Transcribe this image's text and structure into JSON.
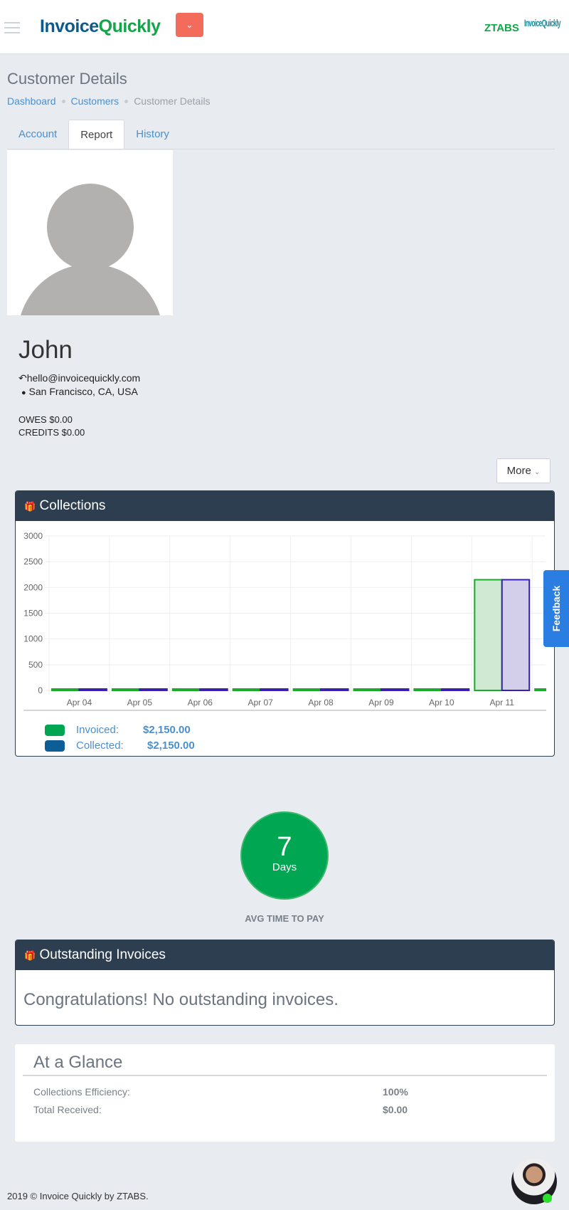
{
  "header": {
    "logo_part1": "Invoice",
    "logo_part2": "Quickly",
    "dropdown_icon": "chevron-down",
    "company": "ZTABS",
    "partner_logo": "InvoiceQuickly"
  },
  "page": {
    "title": "Customer Details",
    "breadcrumb": [
      "Dashboard",
      "Customers",
      "Customer Details"
    ]
  },
  "tabs": [
    {
      "label": "Account"
    },
    {
      "label": "Report"
    },
    {
      "label": "History"
    }
  ],
  "customer": {
    "name": "John",
    "email": "hello@invoicequickly.com",
    "location": "San Francisco, CA, USA",
    "owes": "OWES $0.00",
    "credits": "CREDITS $0.00"
  },
  "more_label": "More",
  "feedback_label": "Feedback",
  "collections": {
    "title": "Collections",
    "legend": [
      {
        "label": "Invoiced:",
        "value": "$2,150.00",
        "color": "#00a651"
      },
      {
        "label": "Collected:",
        "value": "$2,150.00",
        "color": "#0d5e96"
      }
    ]
  },
  "chart_data": {
    "type": "bar",
    "categories": [
      "Apr 04",
      "Apr 05",
      "Apr 06",
      "Apr 07",
      "Apr 08",
      "Apr 09",
      "Apr 10",
      "Apr 11"
    ],
    "series": [
      {
        "name": "Invoiced",
        "values": [
          0,
          0,
          0,
          0,
          0,
          0,
          0,
          2150
        ],
        "fill": "#cfe9d3",
        "stroke": "#1aab2a"
      },
      {
        "name": "Collected",
        "values": [
          0,
          0,
          0,
          0,
          0,
          0,
          0,
          2150
        ],
        "fill": "#d3cfeb",
        "stroke": "#3a1fb0"
      }
    ],
    "ylim": [
      0,
      3000
    ],
    "yticks": [
      0,
      500,
      1000,
      1500,
      2000,
      2500,
      3000
    ],
    "grid": true
  },
  "avg_time": {
    "value": "7",
    "unit": "Days",
    "label": "AVG TIME TO PAY"
  },
  "outstanding": {
    "title": "Outstanding Invoices",
    "message": "Congratulations! No outstanding invoices."
  },
  "glance": {
    "title": "At a Glance",
    "rows": [
      {
        "label": "Collections Efficiency:",
        "value": "100%"
      },
      {
        "label": "Total Received:",
        "value": "$0.00"
      }
    ]
  },
  "footer": "2019 © Invoice Quickly by ZTABS."
}
